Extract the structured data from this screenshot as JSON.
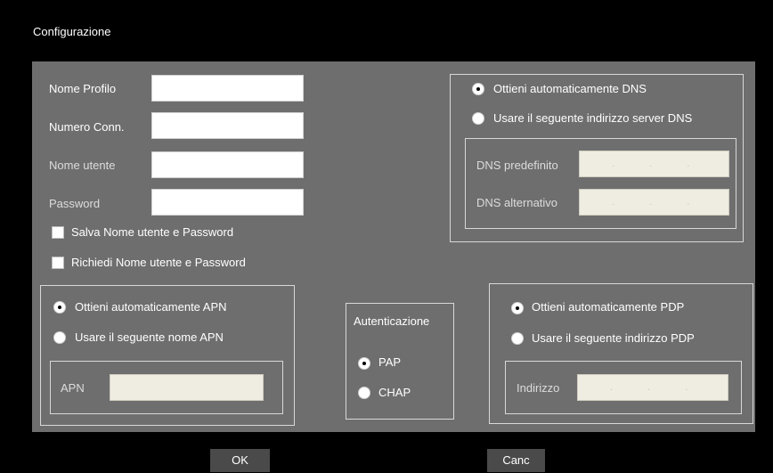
{
  "dialog": {
    "title": "Configurazione"
  },
  "profile": {
    "name_label": "Nome Profilo",
    "number_label": "Numero Conn.",
    "username_label": "Nome utente",
    "password_label": "Password",
    "name_value": "",
    "number_value": "",
    "username_value": "",
    "password_value": "",
    "save_credentials_label": "Salva Nome utente e Password",
    "ask_credentials_label": "Richiedi Nome utente e Password",
    "save_credentials_checked": false,
    "ask_credentials_checked": false
  },
  "dns": {
    "auto_label": "Ottieni automaticamente DNS",
    "manual_label": "Usare il seguente indirizzo server DNS",
    "selected": "auto",
    "primary_label": "DNS predefinito",
    "secondary_label": "DNS alternativo",
    "ip_separators": ". . ."
  },
  "apn": {
    "auto_label": "Ottieni automaticamente APN",
    "manual_label": "Usare il seguente nome APN",
    "selected": "auto",
    "field_label": "APN",
    "field_value": ""
  },
  "auth": {
    "title": "Autenticazione",
    "pap_label": "PAP",
    "chap_label": "CHAP",
    "selected": "PAP"
  },
  "pdp": {
    "auto_label": "Ottieni automaticamente PDP",
    "manual_label": "Usare il seguente indirizzo PDP",
    "selected": "auto",
    "address_label": "Indirizzo",
    "ip_separators": ". . ."
  },
  "buttons": {
    "ok_label": "OK",
    "cancel_label": "Canc"
  },
  "colors": {
    "background": "#000000",
    "panel": "#6e6e6e",
    "disabled_field": "#efece2",
    "button": "#4a4a4a"
  }
}
